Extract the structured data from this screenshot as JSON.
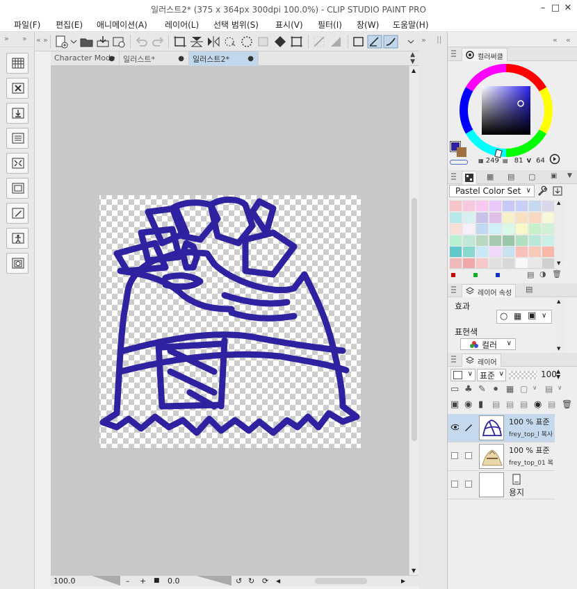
{
  "window": {
    "title": "일러스트2* (375 x 364px 300dpi 100.0%)  - CLIP STUDIO PAINT PRO",
    "minimize_icon": "minimize-icon",
    "maximize_icon": "maximize-icon",
    "close_icon": "close-icon"
  },
  "menu": {
    "items": [
      "파일(F)",
      "편집(E)",
      "애니메이션(A)",
      "레이어(L)",
      "선택 범위(S)",
      "표시(V)",
      "필터(I)",
      "창(W)",
      "도움말(H)"
    ]
  },
  "tabs": [
    {
      "label": "Character Mode",
      "active": false
    },
    {
      "label": "일러스트*",
      "active": false
    },
    {
      "label": "일러스트2*",
      "active": true
    }
  ],
  "status": {
    "zoom": "100.0",
    "rotation": "0.0"
  },
  "color_circle": {
    "tab_label": "컬러써클",
    "h": "249",
    "s": "81",
    "v": "64",
    "v_label": "V",
    "main_color": "#2e22a0",
    "sub_color": "#a07040"
  },
  "color_set": {
    "dropdown": "Pastel Color Set",
    "rows": [
      [
        "#f4c4c8",
        "#f8c8e0",
        "#f8c8f0",
        "#e8c8f8",
        "#c8c8f4",
        "#c8d0f8",
        "#c8d8f0",
        "#d8d8e8"
      ],
      [
        "#b8e8e8",
        "#d8f0f0",
        "#c8c0e8",
        "#e0c0e8",
        "#f8f0c8",
        "#f8e0c0",
        "#f8d8c0",
        "#f8f8d8"
      ],
      [
        "#f8e0d8",
        "#f8f0f8",
        "#c0d8f0",
        "#d0f0f8",
        "#d8f8e8",
        "#f8f8c8",
        "#c8f0c8",
        "#d0f0d8"
      ],
      [
        "#b8f0d0",
        "#c0e8d8",
        "#b8d8c0",
        "#a8c8b0",
        "#98c8a8",
        "#b0e0c0",
        "#b8e8d8",
        "#c8f0e8"
      ],
      [
        "#60c8c8",
        "#88d8d0",
        "#c8e8f8",
        "#f0d8f8",
        "#c8e0f0",
        "#f8c0b8",
        "#f8c8b8",
        "#f8b8a8"
      ],
      [
        "#f0b8b8",
        "#f0a8a8",
        "#f8c8c8",
        "#e0e0e0",
        "#d8d8d8",
        "#f8f8f8",
        "#e8e8e8",
        "#d0d0d0"
      ]
    ]
  },
  "layer_property": {
    "tab_label": "레이어 속성",
    "effect_label": "효과",
    "expression_label": "표현색",
    "expression_value": "컬러"
  },
  "layers_panel": {
    "tab_label": "레이어",
    "blend_mode": "표준",
    "opacity": "100",
    "layers": [
      {
        "line1": "100 % 표준",
        "line2": "frey_top_l 복사",
        "selected": true,
        "visible": true
      },
      {
        "line1": "100 % 표준",
        "line2": "frey_top_01 복",
        "selected": false,
        "visible": false
      },
      {
        "line1": "",
        "line2": "용지",
        "selected": false,
        "visible": false
      }
    ]
  },
  "drawing": {
    "stroke_color": "#2e22a0"
  }
}
